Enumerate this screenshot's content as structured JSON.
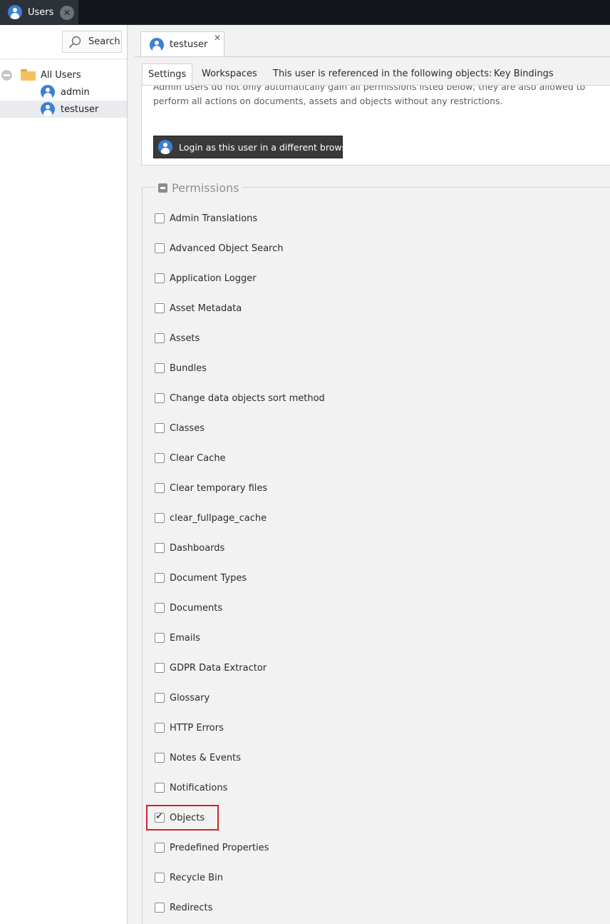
{
  "topbar": {
    "tab_label": "Users",
    "close_label": "✕"
  },
  "sidebar": {
    "search_label": "Search",
    "tree": {
      "root": "All Users",
      "users": [
        "admin",
        "testuser"
      ]
    }
  },
  "document_tab": {
    "label": "testuser",
    "close_label": "✕"
  },
  "settings_tabs": [
    "Settings",
    "Workspaces",
    "This user is referenced in the following objects:",
    "Key Bindings"
  ],
  "admin_note": {
    "line1": "Admin users do not only automatically gain all permissions listed below, they are also allowed to",
    "line2": "perform all actions on documents, assets and objects without any restrictions."
  },
  "login_button_label": "Login as this user in a different browser",
  "permissions": {
    "title": "Permissions",
    "items": [
      {
        "label": "Admin Translations",
        "checked": false
      },
      {
        "label": "Advanced Object Search",
        "checked": false
      },
      {
        "label": "Application Logger",
        "checked": false
      },
      {
        "label": "Asset Metadata",
        "checked": false
      },
      {
        "label": "Assets",
        "checked": false
      },
      {
        "label": "Bundles",
        "checked": false
      },
      {
        "label": "Change data objects sort method",
        "checked": false
      },
      {
        "label": "Classes",
        "checked": false
      },
      {
        "label": "Clear Cache",
        "checked": false
      },
      {
        "label": "Clear temporary files",
        "checked": false
      },
      {
        "label": "clear_fullpage_cache",
        "checked": false
      },
      {
        "label": "Dashboards",
        "checked": false
      },
      {
        "label": "Document Types",
        "checked": false
      },
      {
        "label": "Documents",
        "checked": false
      },
      {
        "label": "Emails",
        "checked": false
      },
      {
        "label": "GDPR Data Extractor",
        "checked": false
      },
      {
        "label": "Glossary",
        "checked": false
      },
      {
        "label": "HTTP Errors",
        "checked": false
      },
      {
        "label": "Notes & Events",
        "checked": false
      },
      {
        "label": "Notifications",
        "checked": false
      },
      {
        "label": "Objects",
        "checked": true
      },
      {
        "label": "Predefined Properties",
        "checked": false
      },
      {
        "label": "Recycle Bin",
        "checked": false
      },
      {
        "label": "Redirects",
        "checked": false
      }
    ]
  },
  "colors": {
    "accent": "#3c7fd6",
    "highlight": "#d0232b",
    "topbar": "#13171c"
  }
}
